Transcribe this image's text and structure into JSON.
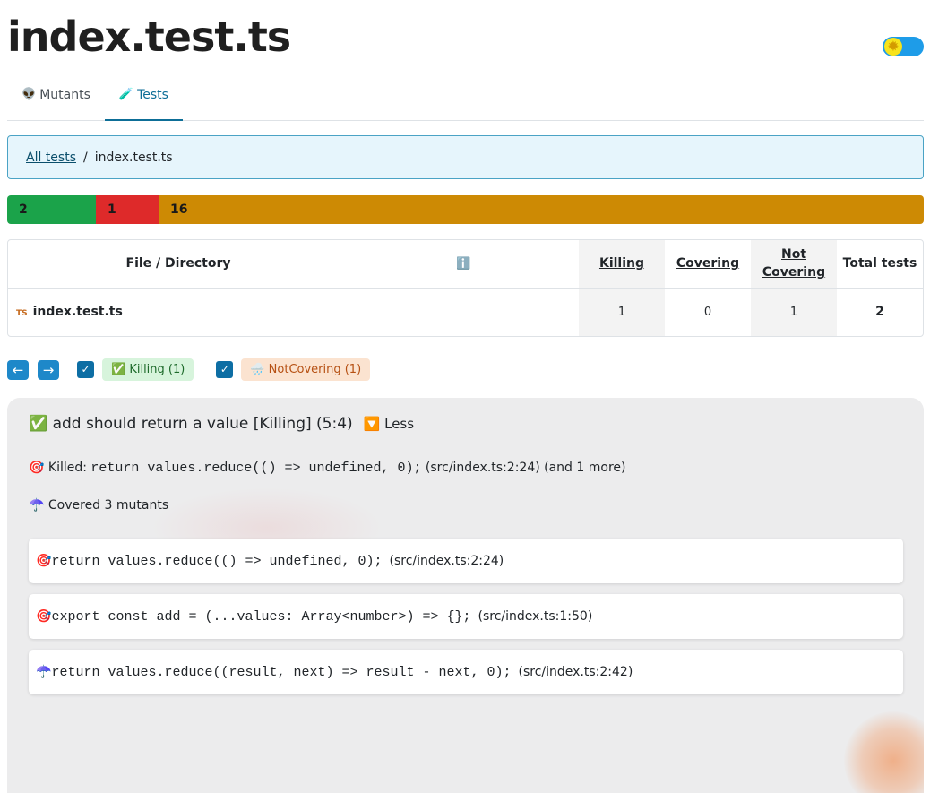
{
  "page": {
    "title": "index.test.ts"
  },
  "tabs": [
    {
      "icon": "👽",
      "label": "Mutants"
    },
    {
      "icon": "🧪",
      "label": "Tests"
    }
  ],
  "breadcrumb": {
    "root": "All tests",
    "separator": "/",
    "current": "index.test.ts"
  },
  "status_bar": {
    "segments": [
      {
        "value": "2",
        "count": 2,
        "color": "#1ba34a"
      },
      {
        "value": "1",
        "count": 1,
        "color": "#de2a2a"
      },
      {
        "value": "16",
        "count": 16,
        "color": "#cd8a04"
      }
    ]
  },
  "metrics_table": {
    "headers": {
      "file": "File / Directory",
      "info": "ℹ️",
      "killing": "Killing",
      "covering": "Covering",
      "not_covering_1": "Not",
      "not_covering_2": "Covering",
      "total": "Total tests"
    },
    "rows": [
      {
        "badge": "TS",
        "name": "index.test.ts",
        "killing": "1",
        "covering": "0",
        "not_covering": "1",
        "total": "2"
      }
    ]
  },
  "filters": {
    "prev": "←",
    "next": "→",
    "killing": {
      "label": "✅ Killing (1)",
      "checked": true
    },
    "not_covering": {
      "label": "🌧️ NotCovering (1)",
      "checked": true
    }
  },
  "test": {
    "icon": "✅",
    "title": "add should return a value [Killing] (5:4)",
    "less_label": "🔽 Less",
    "killed_prefix": "🎯 Killed:",
    "killed_code": "return values.reduce(() => undefined, 0);",
    "killed_suffix": "(src/index.ts:2:24) (and 1 more)",
    "covered_label": "☂️ Covered 3 mutants",
    "mutants": [
      {
        "icon": "🎯",
        "code": "return values.reduce(() => undefined, 0);",
        "location": "(src/index.ts:2:24)"
      },
      {
        "icon": "🎯",
        "code": "export const add = (...values: Array<number>) => {};",
        "location": "(src/index.ts:1:50)"
      },
      {
        "icon": "☂️",
        "code": "return values.reduce((result, next) => result - next, 0);",
        "location": "(src/index.ts:2:42)"
      }
    ]
  }
}
